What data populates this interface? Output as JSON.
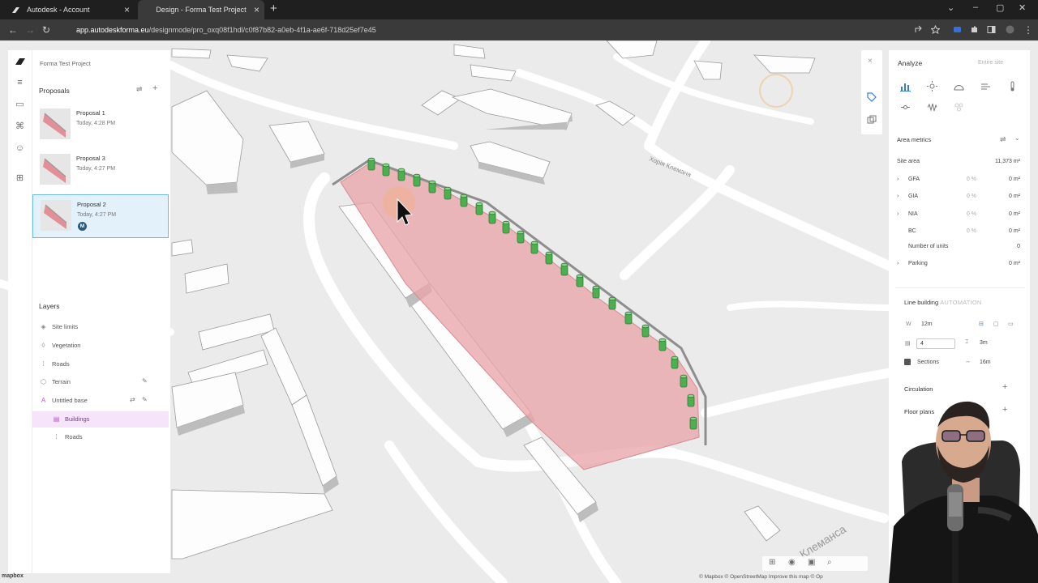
{
  "browser": {
    "tabs": [
      {
        "title": "Autodesk - Account",
        "active": false
      },
      {
        "title": "Design - Forma Test Project",
        "active": true
      }
    ],
    "url_host": "app.autodeskforma.eu",
    "url_path": "/designmode/pro_oxq08f1hdl/c0f87b82-a0eb-4f1a-ae6f-718d25ef7e45"
  },
  "sidebar": {
    "project_name": "Forma Test Project",
    "proposals_title": "Proposals",
    "proposals": [
      {
        "name": "Proposal 1",
        "date": "Today, 4:28 PM",
        "selected": false
      },
      {
        "name": "Proposal 3",
        "date": "Today, 4:27 PM",
        "selected": false
      },
      {
        "name": "Proposal 2",
        "date": "Today, 4:27 PM",
        "selected": true,
        "badge": "M"
      }
    ],
    "layers_title": "Layers",
    "layers": [
      {
        "name": "Site limits",
        "icon": "eye-icon"
      },
      {
        "name": "Vegetation",
        "icon": "tree-icon"
      },
      {
        "name": "Roads",
        "icon": "road-icon"
      },
      {
        "name": "Terrain",
        "icon": "terrain-icon"
      },
      {
        "name": "Untitled base",
        "icon": "base-icon"
      },
      {
        "name": "Buildings",
        "icon": "buildings-icon",
        "active": true
      },
      {
        "name": "Roads",
        "icon": "road-icon"
      }
    ]
  },
  "analyze": {
    "title": "Analyze",
    "scope": "Entire site",
    "area_metrics_title": "Area metrics",
    "site_area_label": "Site area",
    "site_area_value": "11,373 m²",
    "metrics": [
      {
        "label": "GFA",
        "pct": "0 %",
        "value": "0 m²",
        "expand": true
      },
      {
        "label": "GIA",
        "pct": "0 %",
        "value": "0 m²",
        "expand": true
      },
      {
        "label": "NIA",
        "pct": "0 %",
        "value": "0 m²",
        "expand": true
      },
      {
        "label": "BC",
        "pct": "0 %",
        "value": "0 m²",
        "expand": false
      },
      {
        "label": "Number of units",
        "pct": "",
        "value": "0",
        "expand": false
      },
      {
        "label": "Parking",
        "pct": "",
        "value": "0 m²",
        "expand": true
      }
    ]
  },
  "line_building": {
    "title": "Line building",
    "tag": "AUTOMATION",
    "width_label": "W",
    "width_value": "12m",
    "floors_value": "4",
    "floor_height_value": "3m",
    "sections_label": "Sections",
    "section_length_value": "16m",
    "circulation_label": "Circulation",
    "floor_plans_label": "Floor plans"
  },
  "map": {
    "street_label_1": "Хорія Клемана",
    "street_label_2": "Клеманса",
    "attribution": "© Mapbox © OpenStreetMap Improve this map © Op",
    "logo": "mapbox"
  }
}
